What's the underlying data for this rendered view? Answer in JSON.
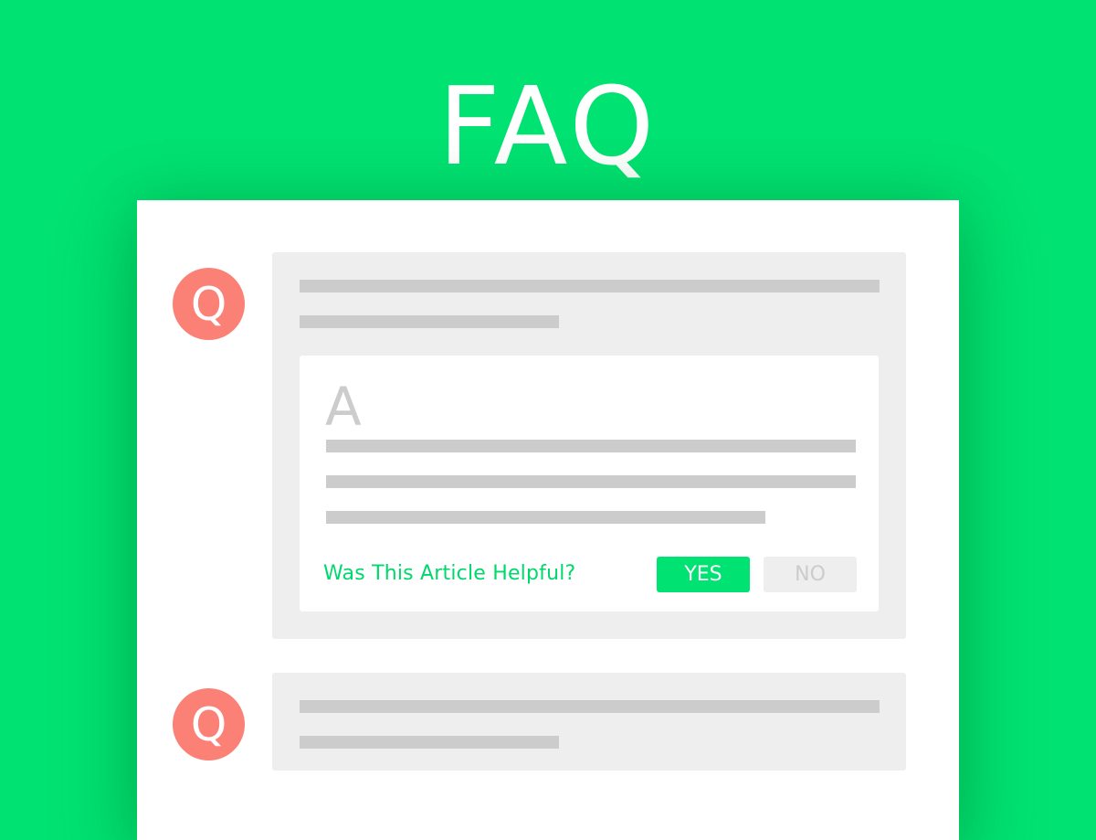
{
  "header": {
    "title": "FAQ"
  },
  "colors": {
    "background": "#00e272",
    "card": "#ffffff",
    "question_badge": "#fb8176",
    "placeholder_bar": "#cccccc",
    "question_panel": "#eeeeee",
    "accent": "#00d86c"
  },
  "faq": {
    "items": [
      {
        "badge": "Q",
        "expanded": true,
        "answer": {
          "badge": "A",
          "helpful_prompt": "Was This Article Helpful?",
          "yes_label": "YES",
          "no_label": "NO"
        }
      },
      {
        "badge": "Q",
        "expanded": false
      }
    ]
  }
}
